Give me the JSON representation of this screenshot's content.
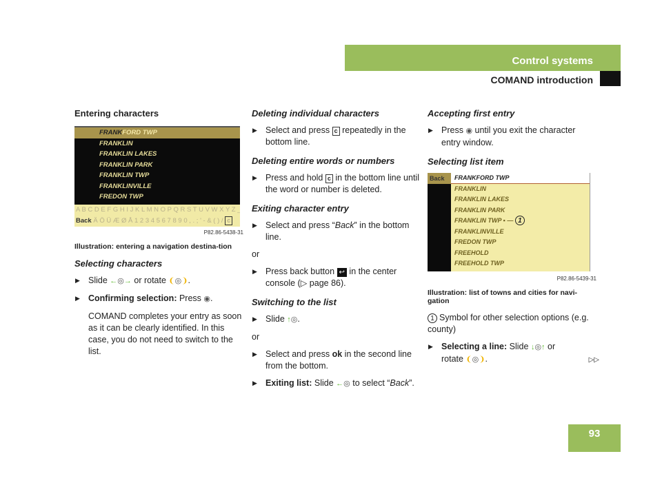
{
  "header": {
    "section": "Control systems",
    "subsection": "COMAND introduction",
    "page_number": "93"
  },
  "colors": {
    "header_green": "#9abd5c"
  },
  "left": {
    "title": "Entering characters",
    "image": {
      "rows": [
        [
          "FRANK",
          "FORD TWP"
        ],
        "FRANKLIN",
        "FRANKLIN LAKES",
        "FRANKLIN PARK",
        "FRANKLIN TWP",
        "FRANKLINVILLE",
        "FREDON TWP"
      ],
      "letters_row": "A B C D E F G H I J K L M N O P Q R S T U V W X Y Z _",
      "ok": "ok",
      "back": "Back",
      "chars_row": "Ä Ö Ü Æ Ø Å 1 2 3 4 5 6 7 8 9 0 , . ; ' - & ( ) /",
      "c": "c",
      "code": "P82.86-5438-31"
    },
    "caption": "Illustration: entering a navigation destina-tion",
    "h_select": "Selecting characters",
    "b1": {
      "a": "Slide",
      "b": "or rotate",
      "c": "."
    },
    "b2": {
      "bold": "Confirming selection:",
      "text": "Press",
      "end": "."
    },
    "para": "COMAND completes your entry as soon as it can be clearly identified. In this case, you do not need to switch to the list."
  },
  "middle": {
    "h1": "Deleting individual characters",
    "b1": {
      "a": "Select and press",
      "b": "repeatedly in the bottom line."
    },
    "h2": "Deleting entire words or numbers",
    "b2": {
      "a": "Press and hold",
      "b": "in the bottom line until the word or number is deleted."
    },
    "h3": "Exiting character entry",
    "b3": {
      "a": "Select and press “",
      "i": "Back",
      "b": "” in the bottom line."
    },
    "or": "or",
    "b4": {
      "a": "Press back button",
      "b": "in the center console (▷ page 86)."
    },
    "h4": "Switching to the list",
    "b5": {
      "a": "Slide",
      "b": "."
    },
    "b6": {
      "a": "Select and press",
      "ok": "ok",
      "b": "in the second line from the bottom."
    },
    "b7": {
      "bold": "Exiting list:",
      "a": "Slide",
      "b": "to select “",
      "i": "Back",
      "c": "”."
    }
  },
  "right": {
    "h1": "Accepting first entry",
    "b1": {
      "a": "Press",
      "b": "until you exit the character entry window."
    },
    "h2": "Selecting list item",
    "image": {
      "back": "Back",
      "rows": [
        "FRANKFORD TWP",
        "FRANKLIN",
        "FRANKLIN LAKES",
        "FRANKLIN PARK",
        "FRANKLIN TWP",
        "FRANKLINVILLE",
        "FREDON TWP",
        "FREEHOLD",
        "FREEHOLD TWP"
      ],
      "callout": "1",
      "code": "P82.86-5439-31"
    },
    "caption": "Illustration: list of towns and cities for navi-gation",
    "note": {
      "num": "1",
      "text": "Symbol for other selection options (e.g. county)"
    },
    "b2": {
      "bold": "Selecting a line:",
      "a": "Slide",
      "b": "or",
      "c": "rotate",
      "d": "."
    },
    "continue": "▷▷"
  }
}
